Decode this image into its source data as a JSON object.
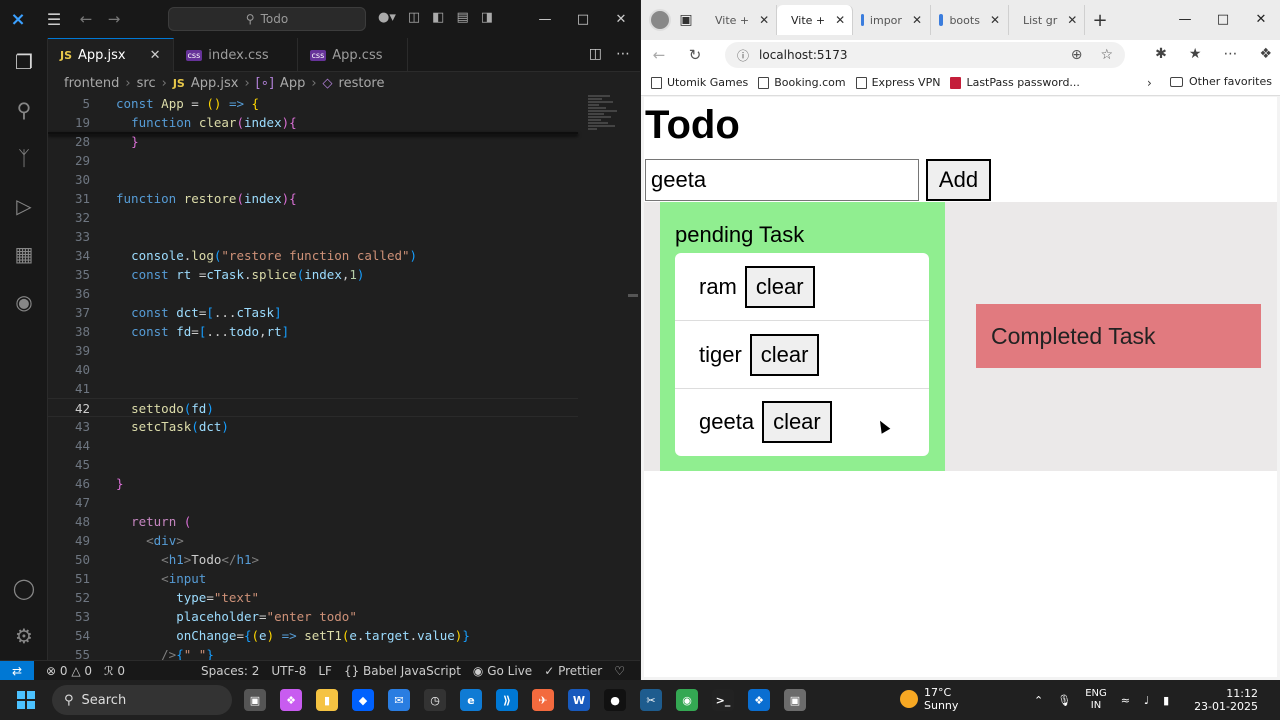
{
  "vscode": {
    "command_center": "Todo",
    "tabs": [
      {
        "label": "App.jsx",
        "type": "JS",
        "active": true
      },
      {
        "label": "index.css",
        "type": "css",
        "active": false
      },
      {
        "label": "App.css",
        "type": "css",
        "active": false
      }
    ],
    "breadcrumb": {
      "folder1": "frontend",
      "folder2": "src",
      "file_type": "JS",
      "file": "App.jsx",
      "sym1": "App",
      "sym2": "restore"
    },
    "gutter": [
      "5",
      "19",
      "28",
      "29",
      "30",
      "31",
      "32",
      "33",
      "34",
      "35",
      "36",
      "37",
      "38",
      "39",
      "40",
      "41",
      "42",
      "43",
      "44",
      "45",
      "46",
      "47",
      "48",
      "49",
      "50",
      "51",
      "52",
      "53",
      "54",
      "55"
    ],
    "current_line": "42",
    "status": {
      "errors": "0",
      "warnings": "0",
      "ports": "0",
      "spaces": "Spaces: 2",
      "encoding": "UTF-8",
      "eol": "LF",
      "language": "Babel JavaScript",
      "golive": "Go Live",
      "prettier": "Prettier"
    }
  },
  "browser": {
    "tabs": [
      {
        "label": "Vite +",
        "fav": "#8a6cff",
        "active": false
      },
      {
        "label": "Vite +",
        "fav": "#8a6cff",
        "active": true
      },
      {
        "label": "impor",
        "fav": "#3b7ddd",
        "active": false
      },
      {
        "label": "boots",
        "fav": "#3b7ddd",
        "active": false
      },
      {
        "label": "List gr",
        "fav": "#7e3bd0",
        "active": false
      }
    ],
    "url": "localhost:5173",
    "bookmarks": [
      "Utomik Games",
      "Booking.com",
      "Express VPN",
      "LastPass password..."
    ],
    "other_favorites": "Other favorites"
  },
  "app": {
    "title": "Todo",
    "input_value": "geeta",
    "add_label": "Add",
    "pending_title": "pending Task",
    "tasks": [
      {
        "name": "ram",
        "button": "clear"
      },
      {
        "name": "tiger",
        "button": "clear"
      },
      {
        "name": "geeta",
        "button": "clear"
      }
    ],
    "completed_title": "Completed Task",
    "colors": {
      "pending": "#90ee90",
      "completed": "#e17a7f",
      "board": "#ebe9e9"
    }
  },
  "taskbar": {
    "search": "Search",
    "temp": "17°C",
    "weather": "Sunny",
    "lang1": "ENG",
    "lang2": "IN",
    "time": "11:12",
    "date": "23-01-2025"
  }
}
